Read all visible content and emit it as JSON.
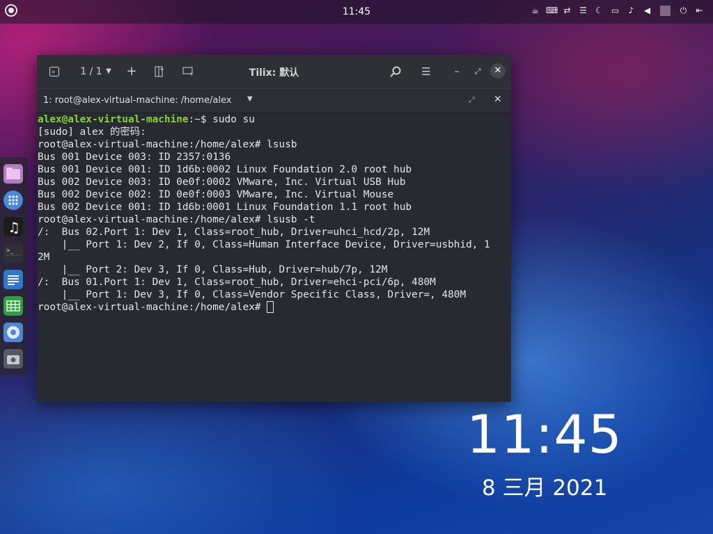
{
  "topbar": {
    "clock": "11:45",
    "icons": [
      "coffee-icon",
      "keyboard-icon",
      "network-icon",
      "menu-icon",
      "night-mode-icon",
      "folder-icon",
      "notification-bell-icon",
      "volume-icon",
      "power-icon",
      "logout-icon"
    ]
  },
  "dock": {
    "items": [
      {
        "name": "files-app",
        "color": "#b47dc2"
      },
      {
        "name": "app-grid",
        "color": "#4a8ad8"
      },
      {
        "name": "music-app",
        "color": "#202020"
      },
      {
        "name": "terminal-app",
        "color": "#303030"
      },
      {
        "name": "text-editor-app",
        "color": "#2f7ad0"
      },
      {
        "name": "spreadsheet-app",
        "color": "#2ea043"
      },
      {
        "name": "chrome-app",
        "color": "#4a8ad8"
      },
      {
        "name": "screenshot-app",
        "color": "#555a66"
      }
    ]
  },
  "window": {
    "title": "Tilix: 默认",
    "session_counter": "1 / 1",
    "tab_title": "1: root@alex-virtual-machine: /home/alex"
  },
  "terminal": {
    "first_prompt_user": "alex@alex-virtual-machine",
    "first_prompt_rest": ":~$ sudo su",
    "lines": [
      "[sudo] alex 的密码:",
      "root@alex-virtual-machine:/home/alex# lsusb",
      "Bus 001 Device 003: ID 2357:0136",
      "Bus 001 Device 001: ID 1d6b:0002 Linux Foundation 2.0 root hub",
      "Bus 002 Device 003: ID 0e0f:0002 VMware, Inc. Virtual USB Hub",
      "Bus 002 Device 002: ID 0e0f:0003 VMware, Inc. Virtual Mouse",
      "Bus 002 Device 001: ID 1d6b:0001 Linux Foundation 1.1 root hub",
      "root@alex-virtual-machine:/home/alex# lsusb -t",
      "/:  Bus 02.Port 1: Dev 1, Class=root_hub, Driver=uhci_hcd/2p, 12M",
      "    |__ Port 1: Dev 2, If 0, Class=Human Interface Device, Driver=usbhid, 1",
      "2M",
      "    |__ Port 2: Dev 3, If 0, Class=Hub, Driver=hub/7p, 12M",
      "/:  Bus 01.Port 1: Dev 1, Class=root_hub, Driver=ehci-pci/6p, 480M",
      "    |__ Port 1: Dev 3, If 0, Class=Vendor Specific Class, Driver=, 480M"
    ],
    "current_prompt": "root@alex-virtual-machine:/home/alex# "
  },
  "desktop": {
    "clock": "11:45",
    "date": "8 三月 2021"
  }
}
